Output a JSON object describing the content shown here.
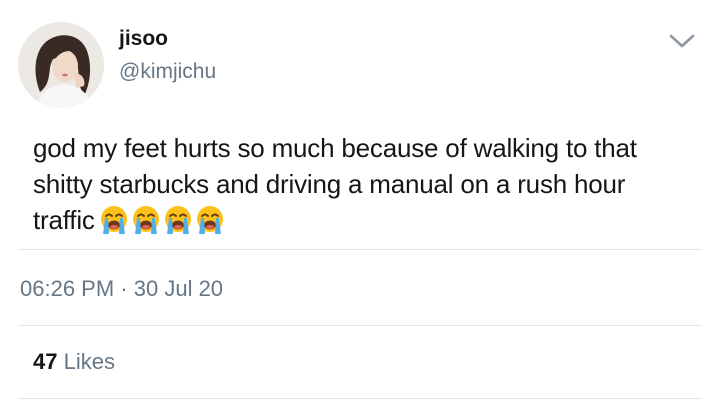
{
  "tweet": {
    "author": {
      "display_name": "jisoo",
      "handle": "@kimjichu"
    },
    "text": "god my feet hurts so much because of walking to that shitty starbucks and driving a manual on a rush hour traffic",
    "emojis": [
      "loudly-crying-face",
      "loudly-crying-face",
      "loudly-crying-face",
      "loudly-crying-face"
    ],
    "time": "06:26 PM",
    "separator": "·",
    "date": "30 Jul 20",
    "likes_count": "47",
    "likes_label": "Likes",
    "menu_icon": "chevron-down-icon"
  }
}
